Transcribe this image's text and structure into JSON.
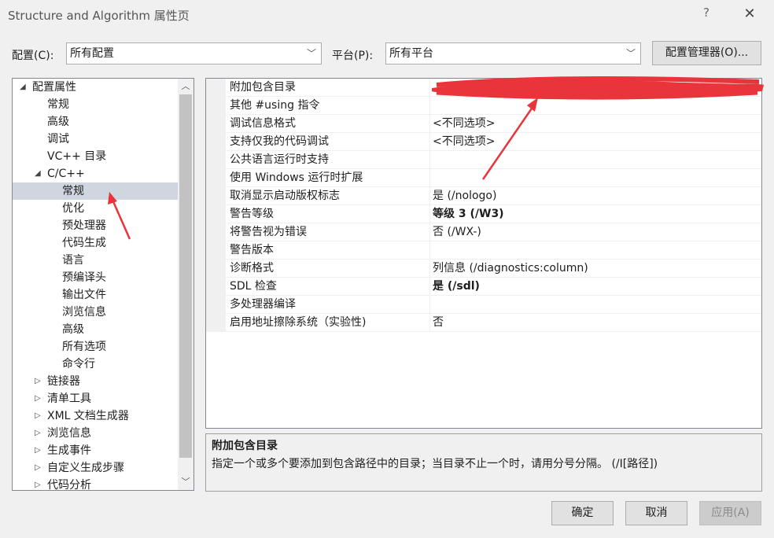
{
  "window": {
    "title": "Structure and Algorithm 属性页",
    "help_glyph": "?",
    "close_glyph": "✕"
  },
  "config_bar": {
    "config_label": "配置(C):",
    "config_value": "所有配置",
    "platform_label": "平台(P):",
    "platform_value": "所有平台",
    "manager_button": "配置管理器(O)..."
  },
  "tree": {
    "items": [
      {
        "label": "配置属性",
        "level": 0,
        "twisty": "◢",
        "selected": false
      },
      {
        "label": "常规",
        "level": 1,
        "twisty": "",
        "selected": false
      },
      {
        "label": "高级",
        "level": 1,
        "twisty": "",
        "selected": false
      },
      {
        "label": "调试",
        "level": 1,
        "twisty": "",
        "selected": false
      },
      {
        "label": "VC++ 目录",
        "level": 1,
        "twisty": "",
        "selected": false
      },
      {
        "label": "C/C++",
        "level": 1,
        "twisty": "◢",
        "selected": false
      },
      {
        "label": "常规",
        "level": 2,
        "twisty": "",
        "selected": true
      },
      {
        "label": "优化",
        "level": 2,
        "twisty": "",
        "selected": false
      },
      {
        "label": "预处理器",
        "level": 2,
        "twisty": "",
        "selected": false
      },
      {
        "label": "代码生成",
        "level": 2,
        "twisty": "",
        "selected": false
      },
      {
        "label": "语言",
        "level": 2,
        "twisty": "",
        "selected": false
      },
      {
        "label": "预编译头",
        "level": 2,
        "twisty": "",
        "selected": false
      },
      {
        "label": "输出文件",
        "level": 2,
        "twisty": "",
        "selected": false
      },
      {
        "label": "浏览信息",
        "level": 2,
        "twisty": "",
        "selected": false
      },
      {
        "label": "高级",
        "level": 2,
        "twisty": "",
        "selected": false
      },
      {
        "label": "所有选项",
        "level": 2,
        "twisty": "",
        "selected": false
      },
      {
        "label": "命令行",
        "level": 2,
        "twisty": "",
        "selected": false
      },
      {
        "label": "链接器",
        "level": 1,
        "twisty": "▷",
        "selected": false
      },
      {
        "label": "清单工具",
        "level": 1,
        "twisty": "▷",
        "selected": false
      },
      {
        "label": "XML 文档生成器",
        "level": 1,
        "twisty": "▷",
        "selected": false
      },
      {
        "label": "浏览信息",
        "level": 1,
        "twisty": "▷",
        "selected": false
      },
      {
        "label": "生成事件",
        "level": 1,
        "twisty": "▷",
        "selected": false
      },
      {
        "label": "自定义生成步骤",
        "level": 1,
        "twisty": "▷",
        "selected": false
      },
      {
        "label": "代码分析",
        "level": 1,
        "twisty": "▷",
        "selected": false
      }
    ],
    "scroll_up_glyph": "︿",
    "scroll_down_glyph": "﹀"
  },
  "properties": {
    "rows": [
      {
        "name": "附加包含目录",
        "value": "",
        "bold": false,
        "redacted": true
      },
      {
        "name": "其他 #using 指令",
        "value": "",
        "bold": false
      },
      {
        "name": "调试信息格式",
        "value": "<不同选项>",
        "bold": false
      },
      {
        "name": "支持仅我的代码调试",
        "value": "<不同选项>",
        "bold": false
      },
      {
        "name": "公共语言运行时支持",
        "value": "",
        "bold": false
      },
      {
        "name": "使用 Windows 运行时扩展",
        "value": "",
        "bold": false
      },
      {
        "name": "取消显示启动版权标志",
        "value": "是 (/nologo)",
        "bold": false
      },
      {
        "name": "警告等级",
        "value": "等级 3 (/W3)",
        "bold": true
      },
      {
        "name": "将警告视为错误",
        "value": "否 (/WX-)",
        "bold": false
      },
      {
        "name": "警告版本",
        "value": "",
        "bold": false
      },
      {
        "name": "诊断格式",
        "value": "列信息 (/diagnostics:column)",
        "bold": false
      },
      {
        "name": "SDL 检查",
        "value": "是 (/sdl)",
        "bold": true
      },
      {
        "name": "多处理器编译",
        "value": "",
        "bold": false
      },
      {
        "name": "启用地址擦除系统（实验性)",
        "value": "否",
        "bold": false
      }
    ]
  },
  "description": {
    "title": "附加包含目录",
    "text": "指定一个或多个要添加到包含路径中的目录；当目录不止一个时，请用分号分隔。     (/I[路径])"
  },
  "buttons": {
    "ok": "确定",
    "cancel": "取消",
    "apply": "应用(A)"
  },
  "colors": {
    "annotation_red": "#e8343a",
    "selected_bg": "#d0d6e0"
  }
}
